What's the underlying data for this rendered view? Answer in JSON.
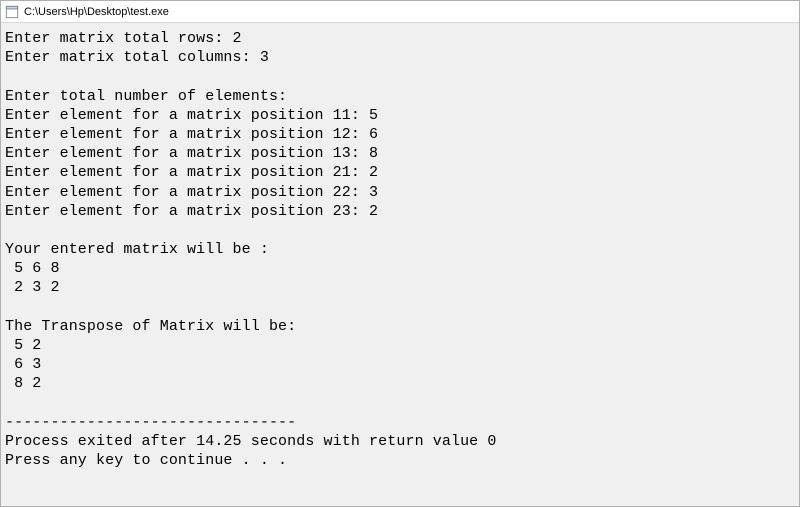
{
  "window": {
    "title": "C:\\Users\\Hp\\Desktop\\test.exe"
  },
  "console": {
    "lines": [
      "Enter matrix total rows: 2",
      "Enter matrix total columns: 3",
      "",
      "Enter total number of elements:",
      "Enter element for a matrix position 11: 5",
      "Enter element for a matrix position 12: 6",
      "Enter element for a matrix position 13: 8",
      "Enter element for a matrix position 21: 2",
      "Enter element for a matrix position 22: 3",
      "Enter element for a matrix position 23: 2",
      "",
      "Your entered matrix will be :",
      " 5 6 8",
      " 2 3 2",
      "",
      "The Transpose of Matrix will be:",
      " 5 2",
      " 6 3",
      " 8 2",
      "",
      "--------------------------------",
      "Process exited after 14.25 seconds with return value 0",
      "Press any key to continue . . ."
    ]
  }
}
